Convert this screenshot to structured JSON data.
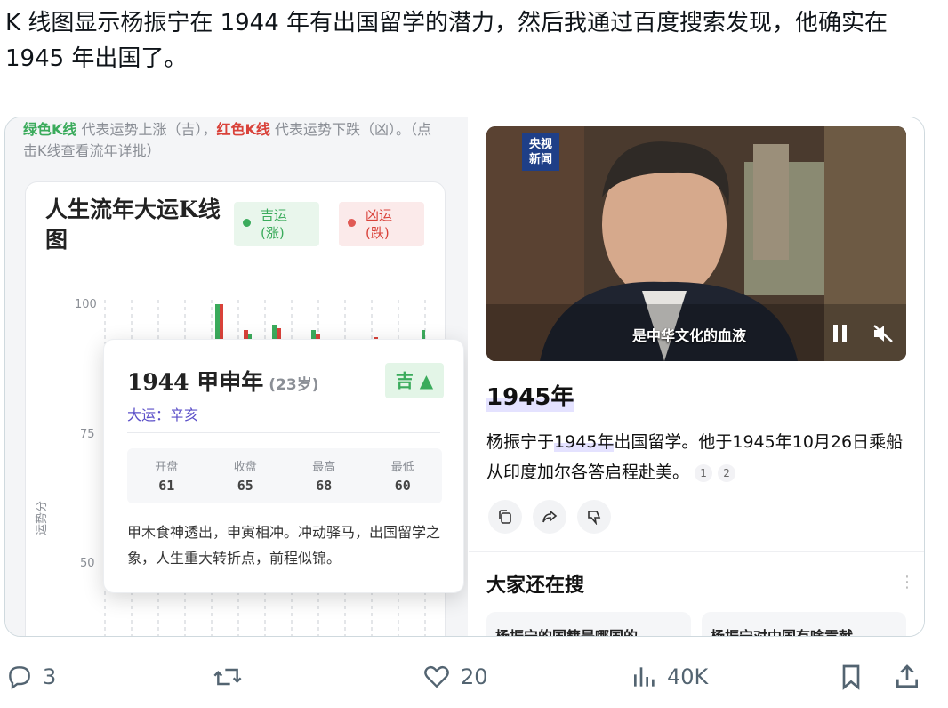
{
  "tweet": {
    "text": "K 线图显示杨振宁在 1944 年有出国留学的潜力，然后我通过百度搜索发现，他确实在 1945 年出国了。"
  },
  "kline_panel": {
    "legend_green": "绿色K线",
    "legend_green_desc": " 代表运势上涨（吉），",
    "legend_red": "红色K线",
    "legend_red_desc": " 代表运势下跌（凶）。（点击K线查看流年详批）",
    "chart_title": "人生流年大运K线图",
    "pill_good": "吉运\n(涨)",
    "pill_good_l1": "吉运",
    "pill_good_l2": "(涨)",
    "pill_bad_l1": "凶运",
    "pill_bad_l2": "(跌)",
    "y_ticks": [
      "100",
      "75",
      "50"
    ],
    "y_title": "运势分",
    "colors": {
      "up": "#3bab5c",
      "down": "#d9423a"
    }
  },
  "popup": {
    "year": "1944 甲申年",
    "age": "(23岁)",
    "badge": "吉 ▲",
    "dayun": "大运：辛亥",
    "stats": [
      {
        "label": "开盘",
        "value": "61"
      },
      {
        "label": "收盘",
        "value": "65"
      },
      {
        "label": "最高",
        "value": "68"
      },
      {
        "label": "最低",
        "value": "60"
      }
    ],
    "desc": "甲木食神透出，申寅相冲。冲动驿马，出国留学之象，人生重大转折点，前程似锦。"
  },
  "answer": {
    "video_logo_l1": "央视",
    "video_logo_l2": "新闻",
    "video_subtitle": "是中华文化的血液",
    "title": "1945年",
    "text_a": "杨振宁于",
    "text_hl": "1945年",
    "text_b": "出国留学。他于1945年10月26日乘船从印度加尔各答启程赴美。",
    "cites": [
      "1",
      "2"
    ],
    "also_title": "大家还在搜",
    "related": [
      "杨振宁的国籍是哪国的",
      "杨振宁对中国有啥贡献"
    ]
  },
  "engagement": {
    "replies": "3",
    "likes": "20",
    "views": "40K"
  }
}
